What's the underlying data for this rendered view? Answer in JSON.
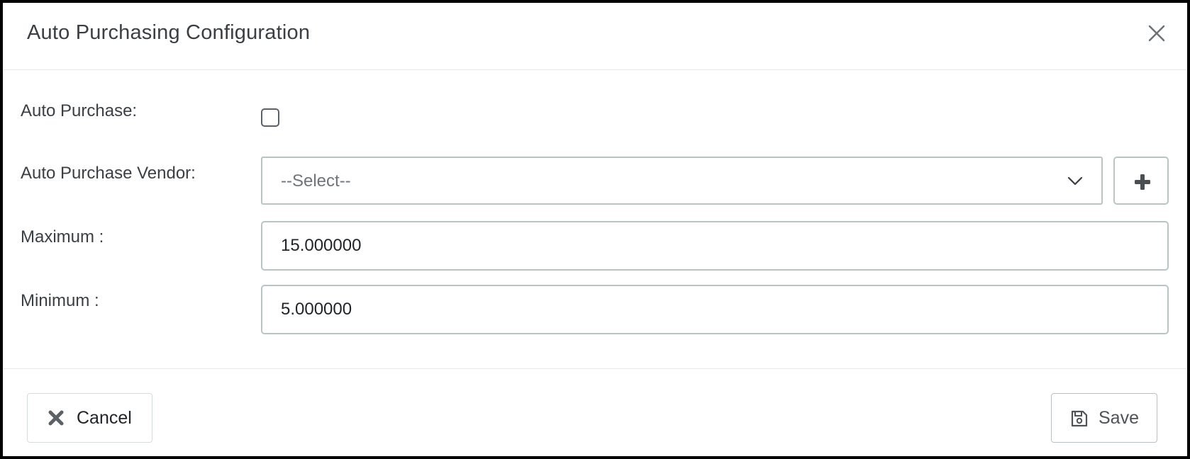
{
  "dialog": {
    "title": "Auto Purchasing Configuration",
    "close_icon": "close-icon"
  },
  "form": {
    "auto_purchase": {
      "label": "Auto Purchase:",
      "checked": false
    },
    "vendor": {
      "label": "Auto Purchase Vendor:",
      "selected": "--Select--",
      "add_icon": "plus-icon",
      "chevron_icon": "chevron-down-icon"
    },
    "maximum": {
      "label": "Maximum :",
      "value": "15.000000"
    },
    "minimum": {
      "label": "Minimum :",
      "value": "5.000000"
    }
  },
  "footer": {
    "cancel_label": "Cancel",
    "cancel_icon": "times-icon",
    "save_label": "Save",
    "save_icon": "floppy-disk-icon"
  },
  "colors": {
    "border": "#b9c4c4",
    "text": "#3a3f44",
    "icon": "#5b6166"
  }
}
